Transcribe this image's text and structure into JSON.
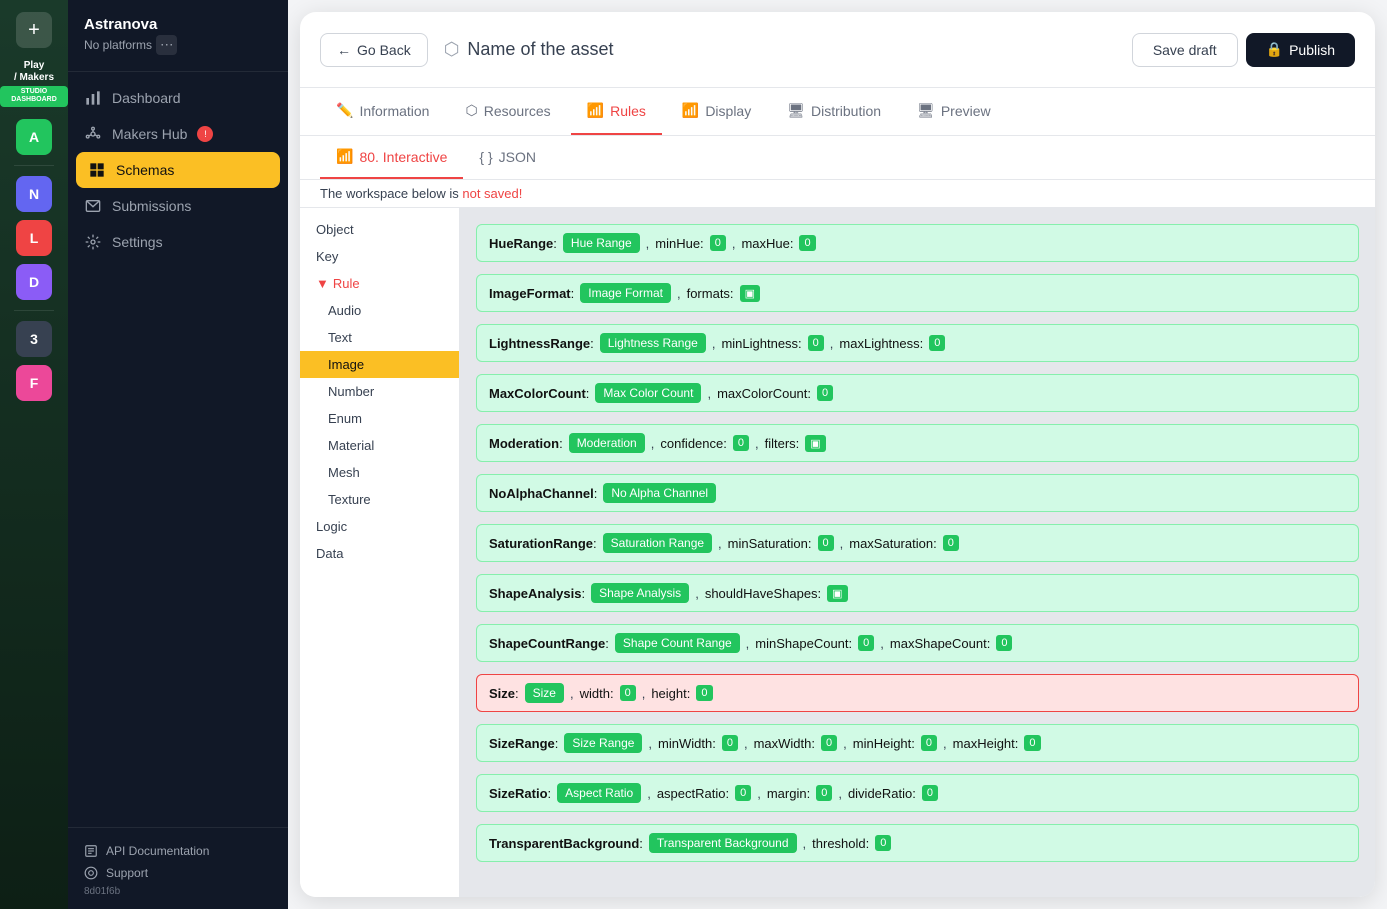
{
  "sidebar": {
    "plus_label": "+",
    "logo_line1": "Play",
    "logo_line2": "/ Makers",
    "logo_badge": "STUDIO DASHBOARD",
    "avatars": [
      {
        "letter": "A",
        "class": "avatar-a"
      },
      {
        "letter": "N",
        "class": "avatar-n"
      },
      {
        "letter": "L",
        "class": "avatar-l"
      },
      {
        "letter": "D",
        "class": "avatar-d"
      },
      {
        "letter": "3",
        "class": "avatar-3"
      },
      {
        "letter": "F",
        "class": "avatar-f"
      }
    ]
  },
  "nav": {
    "title": "Astranova",
    "subtitle": "No platforms",
    "items": [
      {
        "label": "Dashboard",
        "icon": "chart",
        "active": false
      },
      {
        "label": "Makers Hub",
        "icon": "hub",
        "active": false,
        "badge": true
      },
      {
        "label": "Schemas",
        "icon": "grid",
        "active": true
      },
      {
        "label": "Submissions",
        "icon": "inbox",
        "active": false
      },
      {
        "label": "Settings",
        "icon": "gear",
        "active": false
      }
    ],
    "footer": [
      {
        "label": "API Documentation",
        "icon": "doc"
      },
      {
        "label": "Support",
        "icon": "support"
      }
    ],
    "hash": "8d01f6b"
  },
  "header": {
    "back_label": "Go Back",
    "asset_title": "Name of the asset",
    "save_draft": "Save draft",
    "publish": "Publish"
  },
  "tabs": [
    {
      "label": "Information",
      "icon": "✏️",
      "active": false
    },
    {
      "label": "Resources",
      "icon": "⬡",
      "active": false
    },
    {
      "label": "Rules",
      "icon": "📊",
      "active": true
    },
    {
      "label": "Display",
      "icon": "📊",
      "active": false
    },
    {
      "label": "Distribution",
      "icon": "🖥",
      "active": false
    },
    {
      "label": "Preview",
      "icon": "🖥",
      "active": false
    }
  ],
  "subtabs": [
    {
      "label": "80. Interactive",
      "active": true
    },
    {
      "label": "JSON",
      "active": false
    }
  ],
  "warning": {
    "text": "The workspace below is",
    "highlight": "not saved!"
  },
  "tree": [
    {
      "label": "Object",
      "indent": 0,
      "selected": false
    },
    {
      "label": "Key",
      "indent": 0,
      "selected": false
    },
    {
      "label": "Rule",
      "indent": 0,
      "selected": false,
      "highlighted": true,
      "expanded": true,
      "chevron": "▼"
    },
    {
      "label": "Audio",
      "indent": 1,
      "selected": false
    },
    {
      "label": "Text",
      "indent": 1,
      "selected": false
    },
    {
      "label": "Image",
      "indent": 1,
      "selected": true
    },
    {
      "label": "Number",
      "indent": 1,
      "selected": false
    },
    {
      "label": "Enum",
      "indent": 1,
      "selected": false
    },
    {
      "label": "Material",
      "indent": 1,
      "selected": false
    },
    {
      "label": "Mesh",
      "indent": 1,
      "selected": false
    },
    {
      "label": "Texture",
      "indent": 1,
      "selected": false
    },
    {
      "label": "Logic",
      "indent": 0,
      "selected": false
    },
    {
      "label": "Data",
      "indent": 0,
      "selected": false
    }
  ],
  "rules": [
    {
      "key": "HueRange",
      "tag": "Hue Range",
      "fields": [
        {
          "label": "minHue",
          "value": "0"
        },
        {
          "label": "maxHue",
          "value": "0"
        }
      ]
    },
    {
      "key": "ImageFormat",
      "tag": "Image Format",
      "fields": [
        {
          "label": "formats",
          "value": "▣"
        }
      ]
    },
    {
      "key": "LightnessRange",
      "tag": "Lightness Range",
      "fields": [
        {
          "label": "minLightness",
          "value": "0"
        },
        {
          "label": "maxLightness",
          "value": "0"
        }
      ]
    },
    {
      "key": "MaxColorCount",
      "tag": "Max Color Count",
      "fields": [
        {
          "label": "maxColorCount",
          "value": "0"
        }
      ]
    },
    {
      "key": "Moderation",
      "tag": "Moderation",
      "fields": [
        {
          "label": "confidence",
          "value": "0"
        },
        {
          "label": "filters",
          "value": "▣"
        }
      ]
    },
    {
      "key": "NoAlphaChannel",
      "tag": "No Alpha Channel",
      "fields": []
    },
    {
      "key": "SaturationRange",
      "tag": "Saturation Range",
      "fields": [
        {
          "label": "minSaturation",
          "value": "0"
        },
        {
          "label": "maxSaturation",
          "value": "0"
        }
      ]
    },
    {
      "key": "ShapeAnalysis",
      "tag": "Shape Analysis",
      "fields": [
        {
          "label": "shouldHaveShapes",
          "value": "▣"
        }
      ]
    },
    {
      "key": "ShapeCountRange",
      "tag": "Shape Count Range",
      "fields": [
        {
          "label": "minShapeCount",
          "value": "0"
        },
        {
          "label": "maxShapeCount",
          "value": "0"
        }
      ]
    },
    {
      "key": "Size",
      "tag": "Size",
      "fields": [
        {
          "label": "width",
          "value": "0"
        },
        {
          "label": "height",
          "value": "0"
        }
      ],
      "error": true
    },
    {
      "key": "SizeRange",
      "tag": "Size Range",
      "fields": [
        {
          "label": "minWidth",
          "value": "0"
        },
        {
          "label": "maxWidth",
          "value": "0"
        },
        {
          "label": "minHeight",
          "value": "0"
        },
        {
          "label": "maxHeight",
          "value": "0"
        }
      ]
    },
    {
      "key": "SizeRatio",
      "tag": "Aspect Ratio",
      "fields": [
        {
          "label": "aspectRatio",
          "value": "0"
        },
        {
          "label": "margin",
          "value": "0"
        },
        {
          "label": "divideRatio",
          "value": "0"
        }
      ]
    },
    {
      "key": "TransparentBackground",
      "tag": "Transparent Background",
      "fields": [
        {
          "label": "threshold",
          "value": "0"
        }
      ]
    }
  ]
}
